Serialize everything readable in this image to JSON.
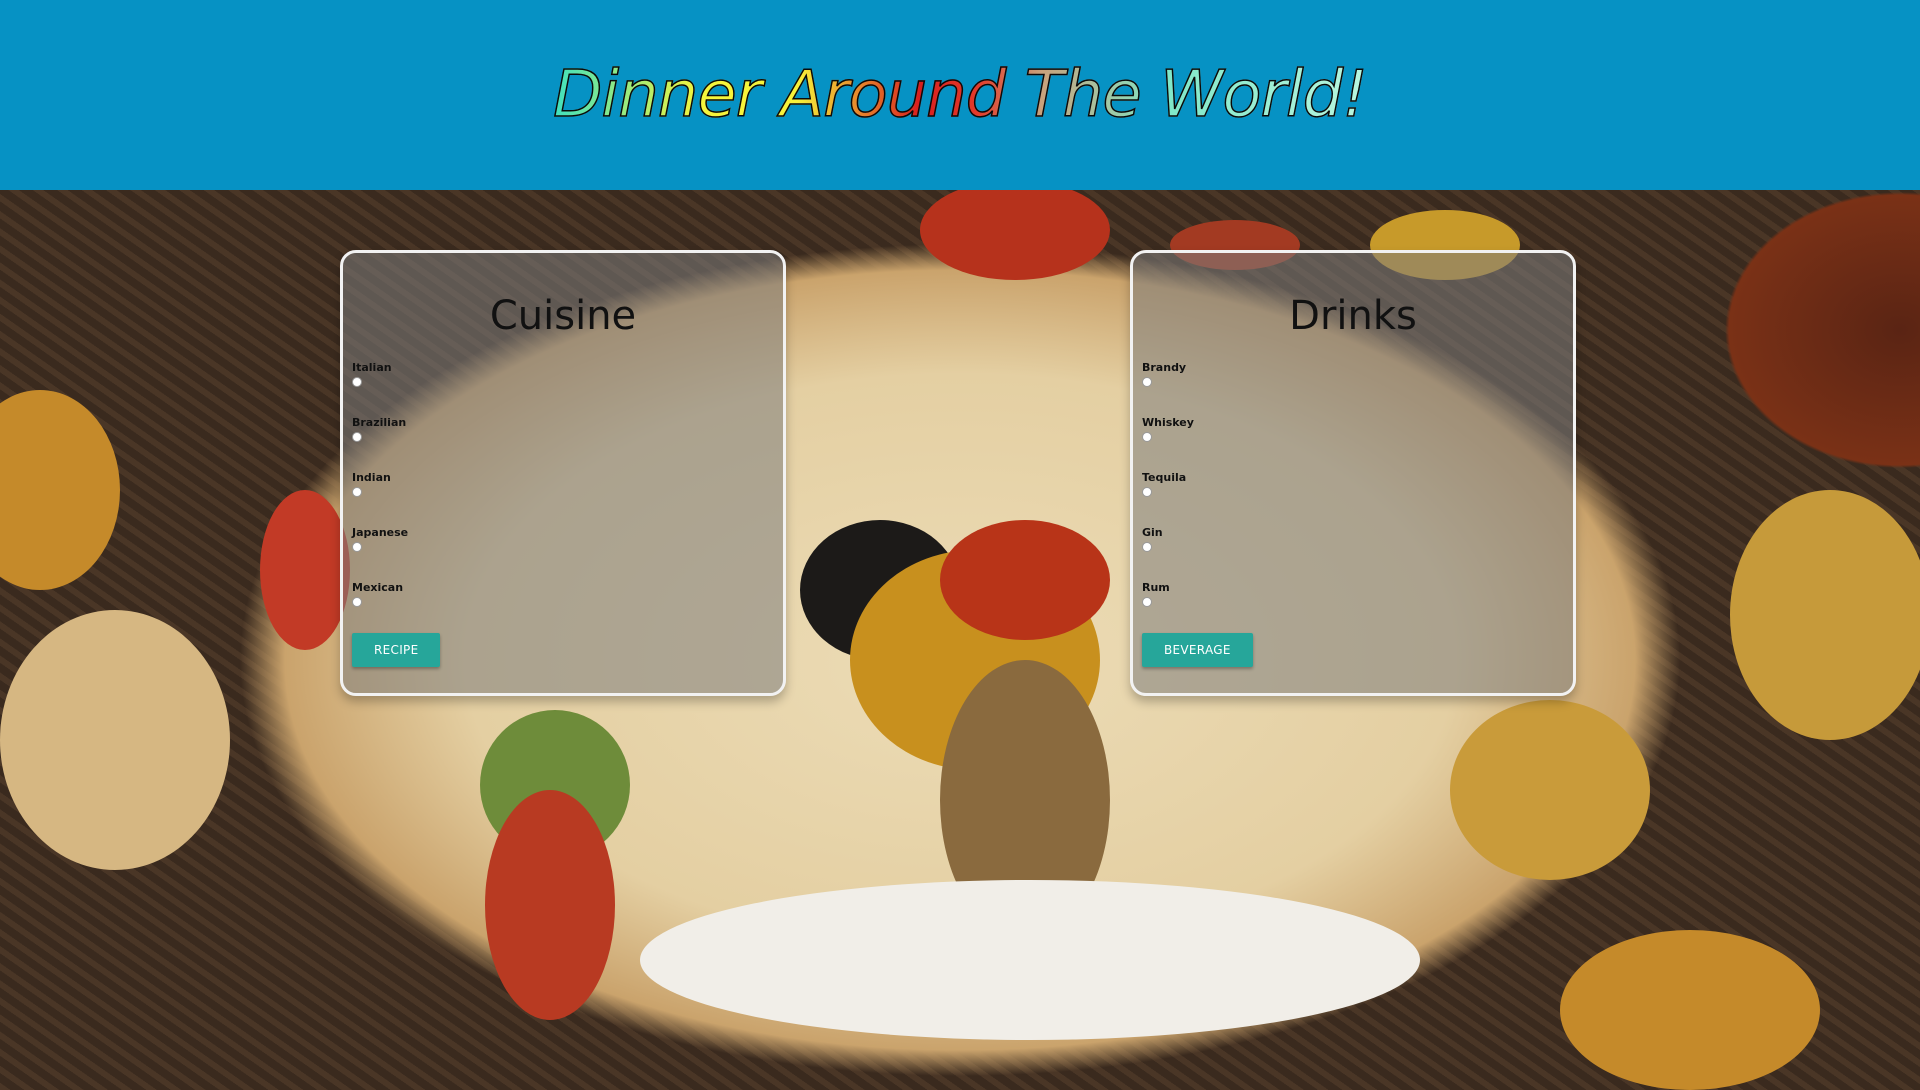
{
  "header": {
    "title": "Dinner Around The World!"
  },
  "cuisine": {
    "heading": "Cuisine",
    "options": [
      "Italian",
      "Brazilian",
      "Indian",
      "Japanese",
      "Mexican"
    ],
    "button_label": "RECIPE"
  },
  "drinks": {
    "heading": "Drinks",
    "options": [
      "Brandy",
      "Whiskey",
      "Tequila",
      "Gin",
      "Rum"
    ],
    "button_label": "BEVERAGE"
  },
  "colors": {
    "header_bg": "#0692c4",
    "button_bg": "#26a69a"
  }
}
